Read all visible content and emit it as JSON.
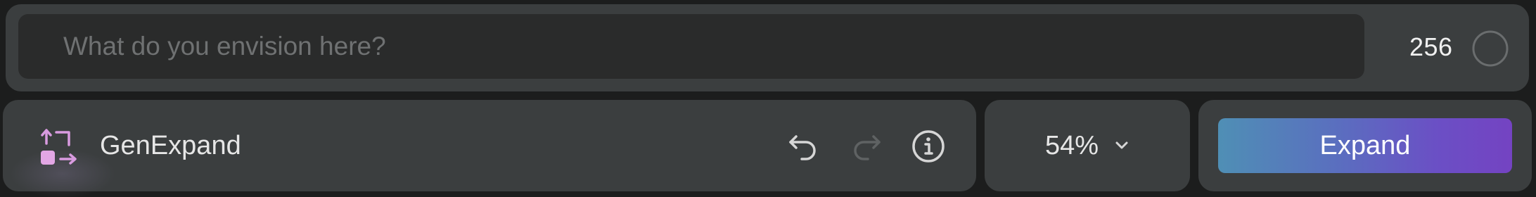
{
  "prompt": {
    "placeholder": "What do you envision here?",
    "value": "",
    "char_remaining": "256"
  },
  "tool": {
    "name": "GenExpand",
    "icon": "gen-expand-icon"
  },
  "history": {
    "undo_icon": "undo-icon",
    "redo_icon": "redo-icon",
    "redo_enabled": false,
    "info_icon": "info-icon"
  },
  "zoom": {
    "value": "54%",
    "icon": "chevron-down-icon"
  },
  "action": {
    "label": "Expand"
  },
  "colors": {
    "panel_bg": "#3b3e3f",
    "input_bg": "#2a2b2b",
    "accent_start": "#4f8fb5",
    "accent_end": "#7443c2",
    "tool_icon_accent": "#d99be0"
  }
}
